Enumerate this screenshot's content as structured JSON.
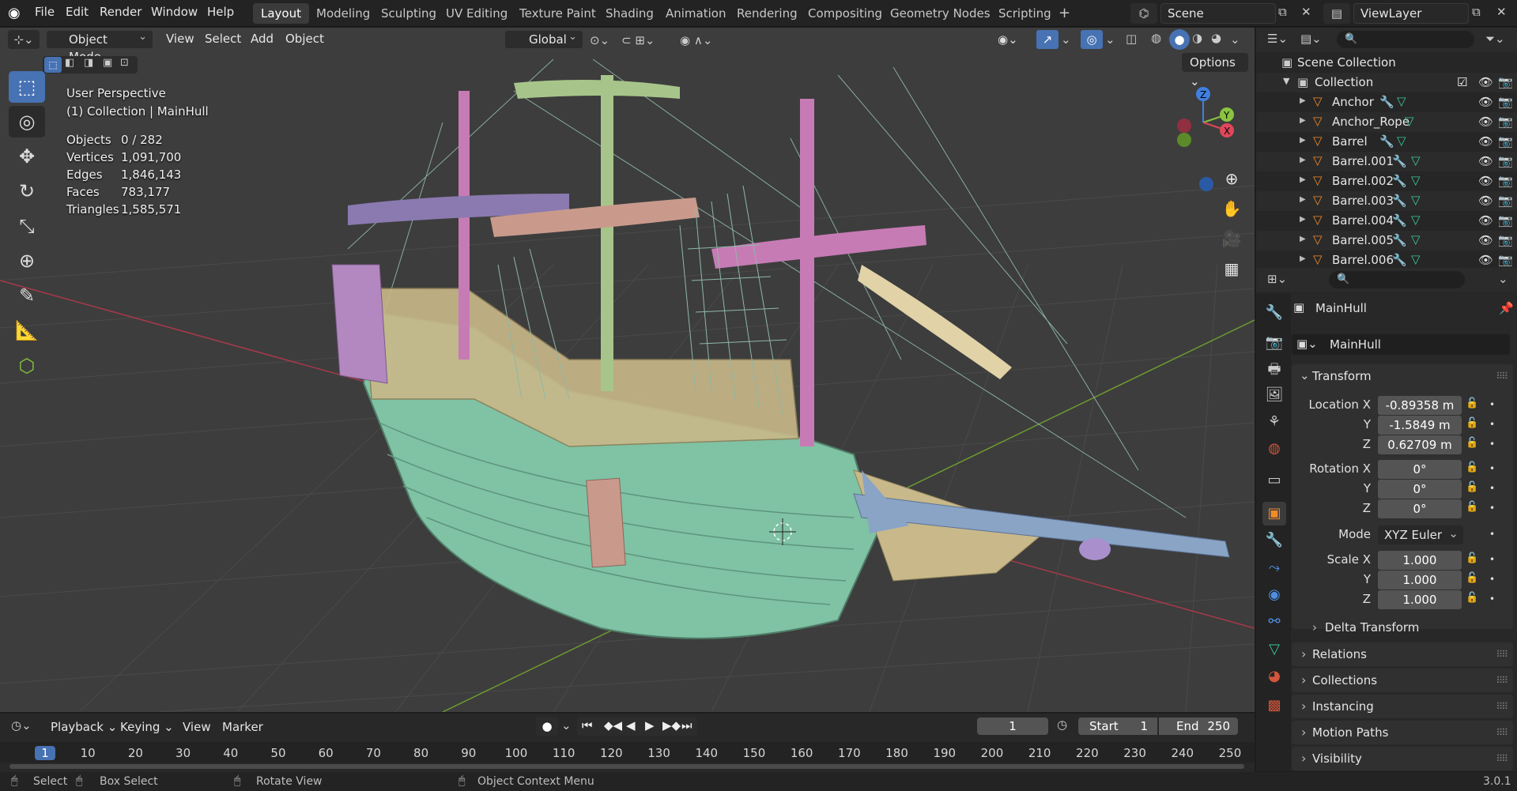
{
  "menus": [
    "File",
    "Edit",
    "Render",
    "Window",
    "Help"
  ],
  "workspaces": [
    "Layout",
    "Modeling",
    "Sculpting",
    "UV Editing",
    "Texture Paint",
    "Shading",
    "Animation",
    "Rendering",
    "Compositing",
    "Geometry Nodes",
    "Scripting"
  ],
  "add_workspace": "+",
  "scene": {
    "name": "Scene",
    "viewlayer": "ViewLayer"
  },
  "viewport_header": {
    "mode": "Object Mode",
    "menus": [
      "View",
      "Select",
      "Add",
      "Object"
    ],
    "orientation": "Global",
    "options": "Options"
  },
  "overlay": {
    "perspective": "User Perspective",
    "collection": "(1) Collection | MainHull",
    "stats": [
      {
        "label": "Objects",
        "value": "0 / 282"
      },
      {
        "label": "Vertices",
        "value": "1,091,700"
      },
      {
        "label": "Edges",
        "value": "1,846,143"
      },
      {
        "label": "Faces",
        "value": "783,177"
      },
      {
        "label": "Triangles",
        "value": "1,585,571"
      }
    ]
  },
  "gizmo": {
    "x": "X",
    "y": "Y",
    "z": "Z"
  },
  "outliner": {
    "root": "Scene Collection",
    "collection": "Collection",
    "items": [
      "Anchor",
      "Anchor_Rope",
      "Barrel",
      "Barrel.001",
      "Barrel.002",
      "Barrel.003",
      "Barrel.004",
      "Barrel.005",
      "Barrel.006"
    ]
  },
  "properties": {
    "object_name": "MainHull",
    "datablock": "MainHull",
    "transform_label": "Transform",
    "location": {
      "label": "Location X",
      "x": "-0.89358 m",
      "y": "-1.5849 m",
      "z": "0.62709 m"
    },
    "rotation": {
      "label": "Rotation X",
      "x": "0°",
      "y": "0°",
      "z": "0°"
    },
    "mode_label": "Mode",
    "mode_value": "XYZ Euler",
    "scale": {
      "label": "Scale X",
      "x": "1.000",
      "y": "1.000",
      "z": "1.000"
    },
    "axis_y": "Y",
    "axis_z": "Z",
    "delta": "Delta Transform",
    "panels": [
      "Relations",
      "Collections",
      "Instancing",
      "Motion Paths",
      "Visibility"
    ]
  },
  "timeline": {
    "menus": [
      "Playback",
      "Keying",
      "View",
      "Marker"
    ],
    "current_frame": "1",
    "start_label": "Start",
    "start": "1",
    "end_label": "End",
    "end": "250",
    "ticks": [
      "1",
      "10",
      "20",
      "30",
      "40",
      "50",
      "60",
      "70",
      "80",
      "90",
      "100",
      "110",
      "120",
      "130",
      "140",
      "150",
      "160",
      "170",
      "180",
      "190",
      "200",
      "210",
      "220",
      "230",
      "240",
      "250"
    ]
  },
  "statusbar": {
    "select": "Select",
    "box_select": "Box Select",
    "rotate": "Rotate View",
    "context": "Object Context Menu",
    "version": "3.0.1"
  },
  "colors": {
    "accent": "#4772b3",
    "hull": "#7fc2a4",
    "trim": "#c9b98a",
    "mast": "#c77bb5",
    "x_axis": "#e0475a",
    "y_axis": "#8ac43f",
    "z_axis": "#3f7fdf"
  }
}
